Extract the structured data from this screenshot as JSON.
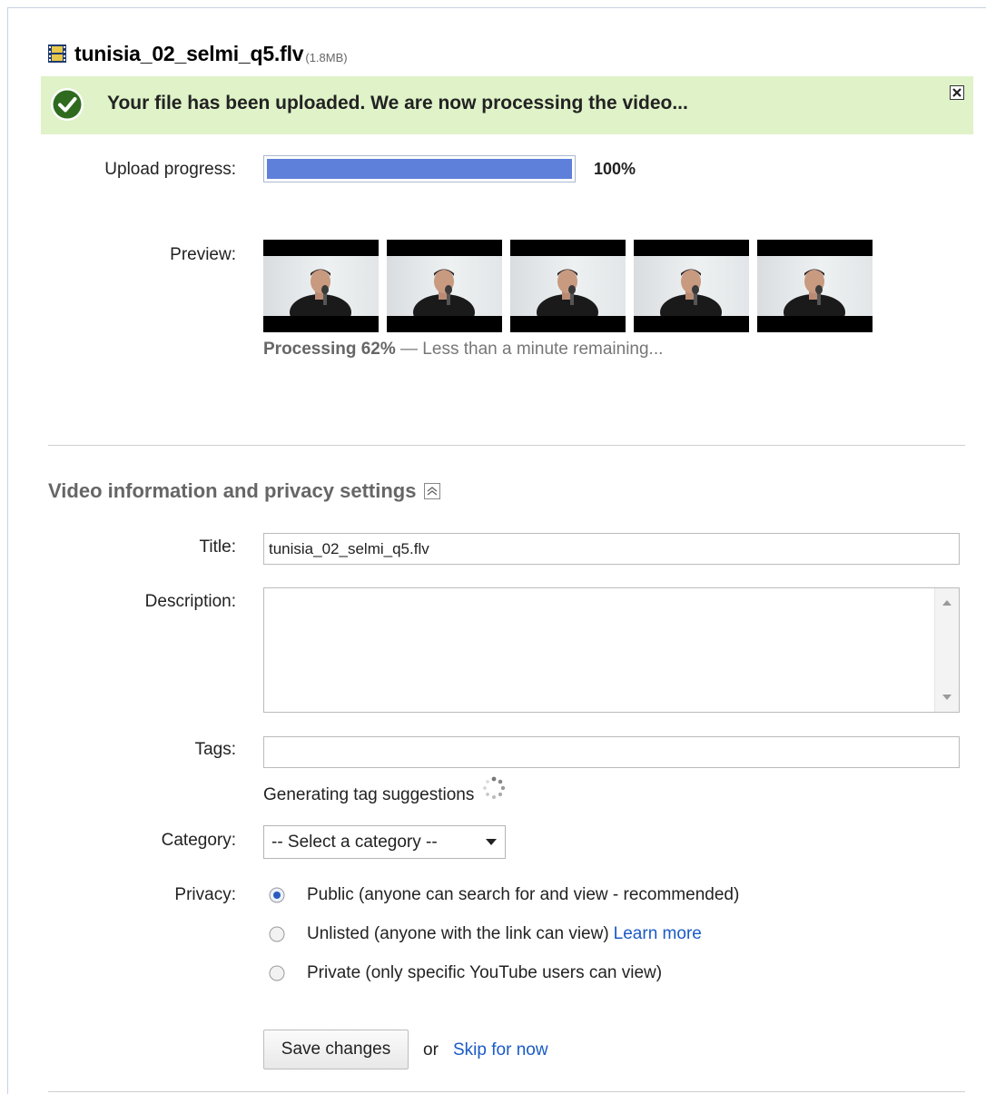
{
  "file": {
    "name": "tunisia_02_selmi_q5.flv",
    "size": "(1.8MB)"
  },
  "banner": {
    "message": "Your file has been uploaded. We are now processing the video..."
  },
  "upload": {
    "label": "Upload progress:",
    "percent_text": "100%",
    "progress_fraction": 1.0
  },
  "preview": {
    "label": "Preview:",
    "thumbnail_count": 5,
    "status_strong": "Processing 62%",
    "status_rest": " — Less than a minute remaining..."
  },
  "section": {
    "title": "Video information and privacy settings"
  },
  "form": {
    "title_label": "Title:",
    "title_value": "tunisia_02_selmi_q5.flv",
    "description_label": "Description:",
    "description_value": "",
    "tags_label": "Tags:",
    "tags_value": "",
    "tag_status": "Generating tag suggestions",
    "category_label": "Category:",
    "category_selected": "-- Select a category --",
    "privacy_label": "Privacy:",
    "privacy_options": [
      {
        "label": "Public (anyone can search for and view - recommended)",
        "selected": true
      },
      {
        "label": "Unlisted (anyone with the link can view)",
        "selected": false,
        "link": "Learn more"
      },
      {
        "label": "Private (only specific YouTube users can view)",
        "selected": false
      }
    ]
  },
  "actions": {
    "save_label": "Save changes",
    "or_text": "or",
    "skip_label": "Skip for now"
  },
  "colors": {
    "banner_bg": "#dff2c8",
    "progress_fill": "#5e80db",
    "link": "#1a5bc6",
    "check_green": "#2e6b1f"
  },
  "icons": [
    "film-icon",
    "check-icon",
    "close-icon",
    "collapse-icon",
    "spinner-icon",
    "caret-down-icon"
  ]
}
